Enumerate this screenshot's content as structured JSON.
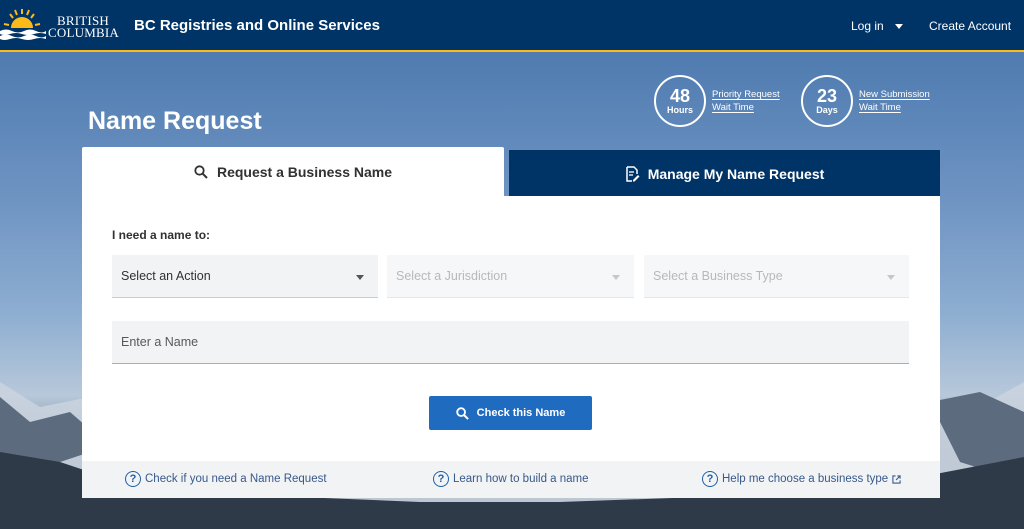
{
  "header": {
    "logo_line1": "BRITISH",
    "logo_line2": "COLUMBIA",
    "app_title": "BC Registries and Online Services",
    "login_label": "Log in",
    "create_account_label": "Create Account"
  },
  "page": {
    "title": "Name Request"
  },
  "wait_times": [
    {
      "value": "48",
      "unit": "Hours",
      "label_line1": "Priority Request",
      "label_line2": "Wait Time"
    },
    {
      "value": "23",
      "unit": "Days",
      "label_line1": "New Submission",
      "label_line2": "Wait Time"
    }
  ],
  "tabs": {
    "request_label": "Request a Business Name",
    "manage_label": "Manage My Name Request"
  },
  "form": {
    "need_label": "I need a name to:",
    "action_placeholder": "Select an Action",
    "jurisdiction_placeholder": "Select a Jurisdiction",
    "business_type_placeholder": "Select a Business Type",
    "name_placeholder": "Enter a Name",
    "check_button_label": "Check this Name"
  },
  "help_links": [
    {
      "label": "Check if you need a Name Request"
    },
    {
      "label": "Learn how to build a name"
    },
    {
      "label": "Help me choose a business type"
    }
  ],
  "colors": {
    "header_bg": "#003366",
    "header_accent": "#fcba19",
    "primary_button": "#1f6bc0",
    "link": "#38598a"
  }
}
